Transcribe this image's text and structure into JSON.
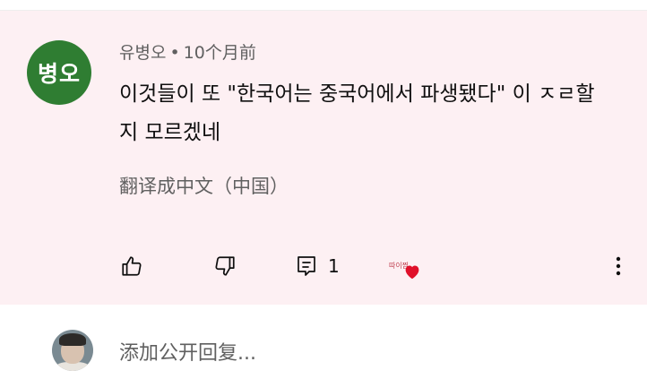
{
  "comment": {
    "avatar_text": "병오",
    "author": "유병오",
    "separator": "•",
    "time": "10个月前",
    "text": "이것들이 또 \"한국어는 중국어에서 파생됐다\" 이 ㅈㄹ할지 모르겠네",
    "translate_label": "翻译成中文（中国）",
    "reply_count": "1",
    "creator_heart_avatar_text": "따이찜",
    "colors": {
      "card_background": "#fdf0f3",
      "avatar_background": "#2f7d32",
      "heart": "#e0102a"
    }
  },
  "actions": {
    "like_icon": "thumbs-up-icon",
    "dislike_icon": "thumbs-down-icon",
    "reply_icon": "comment-reply-icon",
    "more_icon": "vertical-dots-icon"
  },
  "reply_box": {
    "placeholder": "添加公开回复..."
  }
}
